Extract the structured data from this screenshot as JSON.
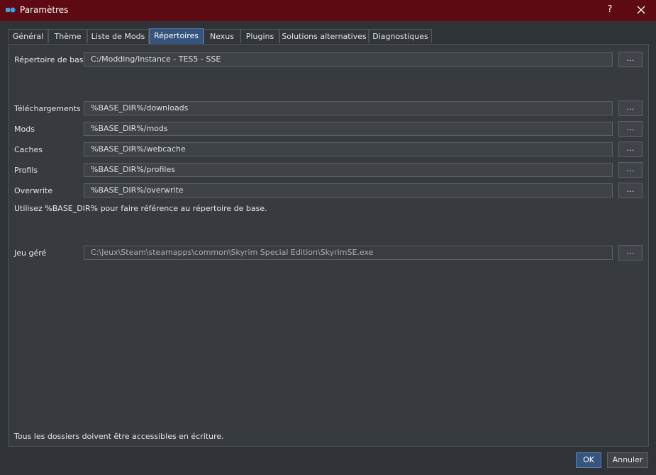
{
  "window": {
    "title": "Paramètres",
    "help_label": "?"
  },
  "tabs": [
    {
      "label": "Général"
    },
    {
      "label": "Thème"
    },
    {
      "label": "Liste de Mods"
    },
    {
      "label": "Répertoires",
      "active": true
    },
    {
      "label": "Nexus"
    },
    {
      "label": "Plugins"
    },
    {
      "label": "Solutions alternatives"
    },
    {
      "label": "Diagnostiques"
    }
  ],
  "directories": {
    "base": {
      "label": "Répertoire de base",
      "value": "C:/Modding/Instance - TES5 - SSE"
    },
    "downloads": {
      "label": "Téléchargements",
      "value": "%BASE_DIR%/downloads"
    },
    "mods": {
      "label": "Mods",
      "value": "%BASE_DIR%/mods"
    },
    "caches": {
      "label": "Caches",
      "value": "%BASE_DIR%/webcache"
    },
    "profiles": {
      "label": "Profils",
      "value": "%BASE_DIR%/profiles"
    },
    "overwrite": {
      "label": "Overwrite",
      "value": "%BASE_DIR%/overwrite"
    },
    "hint": "Utilisez %BASE_DIR% pour faire référence au répertoire de base.",
    "game": {
      "label": "Jeu géré",
      "value": "C:\\Jeux\\Steam\\steamapps\\common\\Skyrim Special Edition\\SkyrimSE.exe"
    },
    "browse_label": "...",
    "footer_note": "Tous les dossiers doivent être accessibles en écriture."
  },
  "buttons": {
    "ok": "OK",
    "cancel": "Annuler"
  },
  "colors": {
    "titlebar": "#5e0a12",
    "accent": "#35557d",
    "background": "#2f3237"
  }
}
